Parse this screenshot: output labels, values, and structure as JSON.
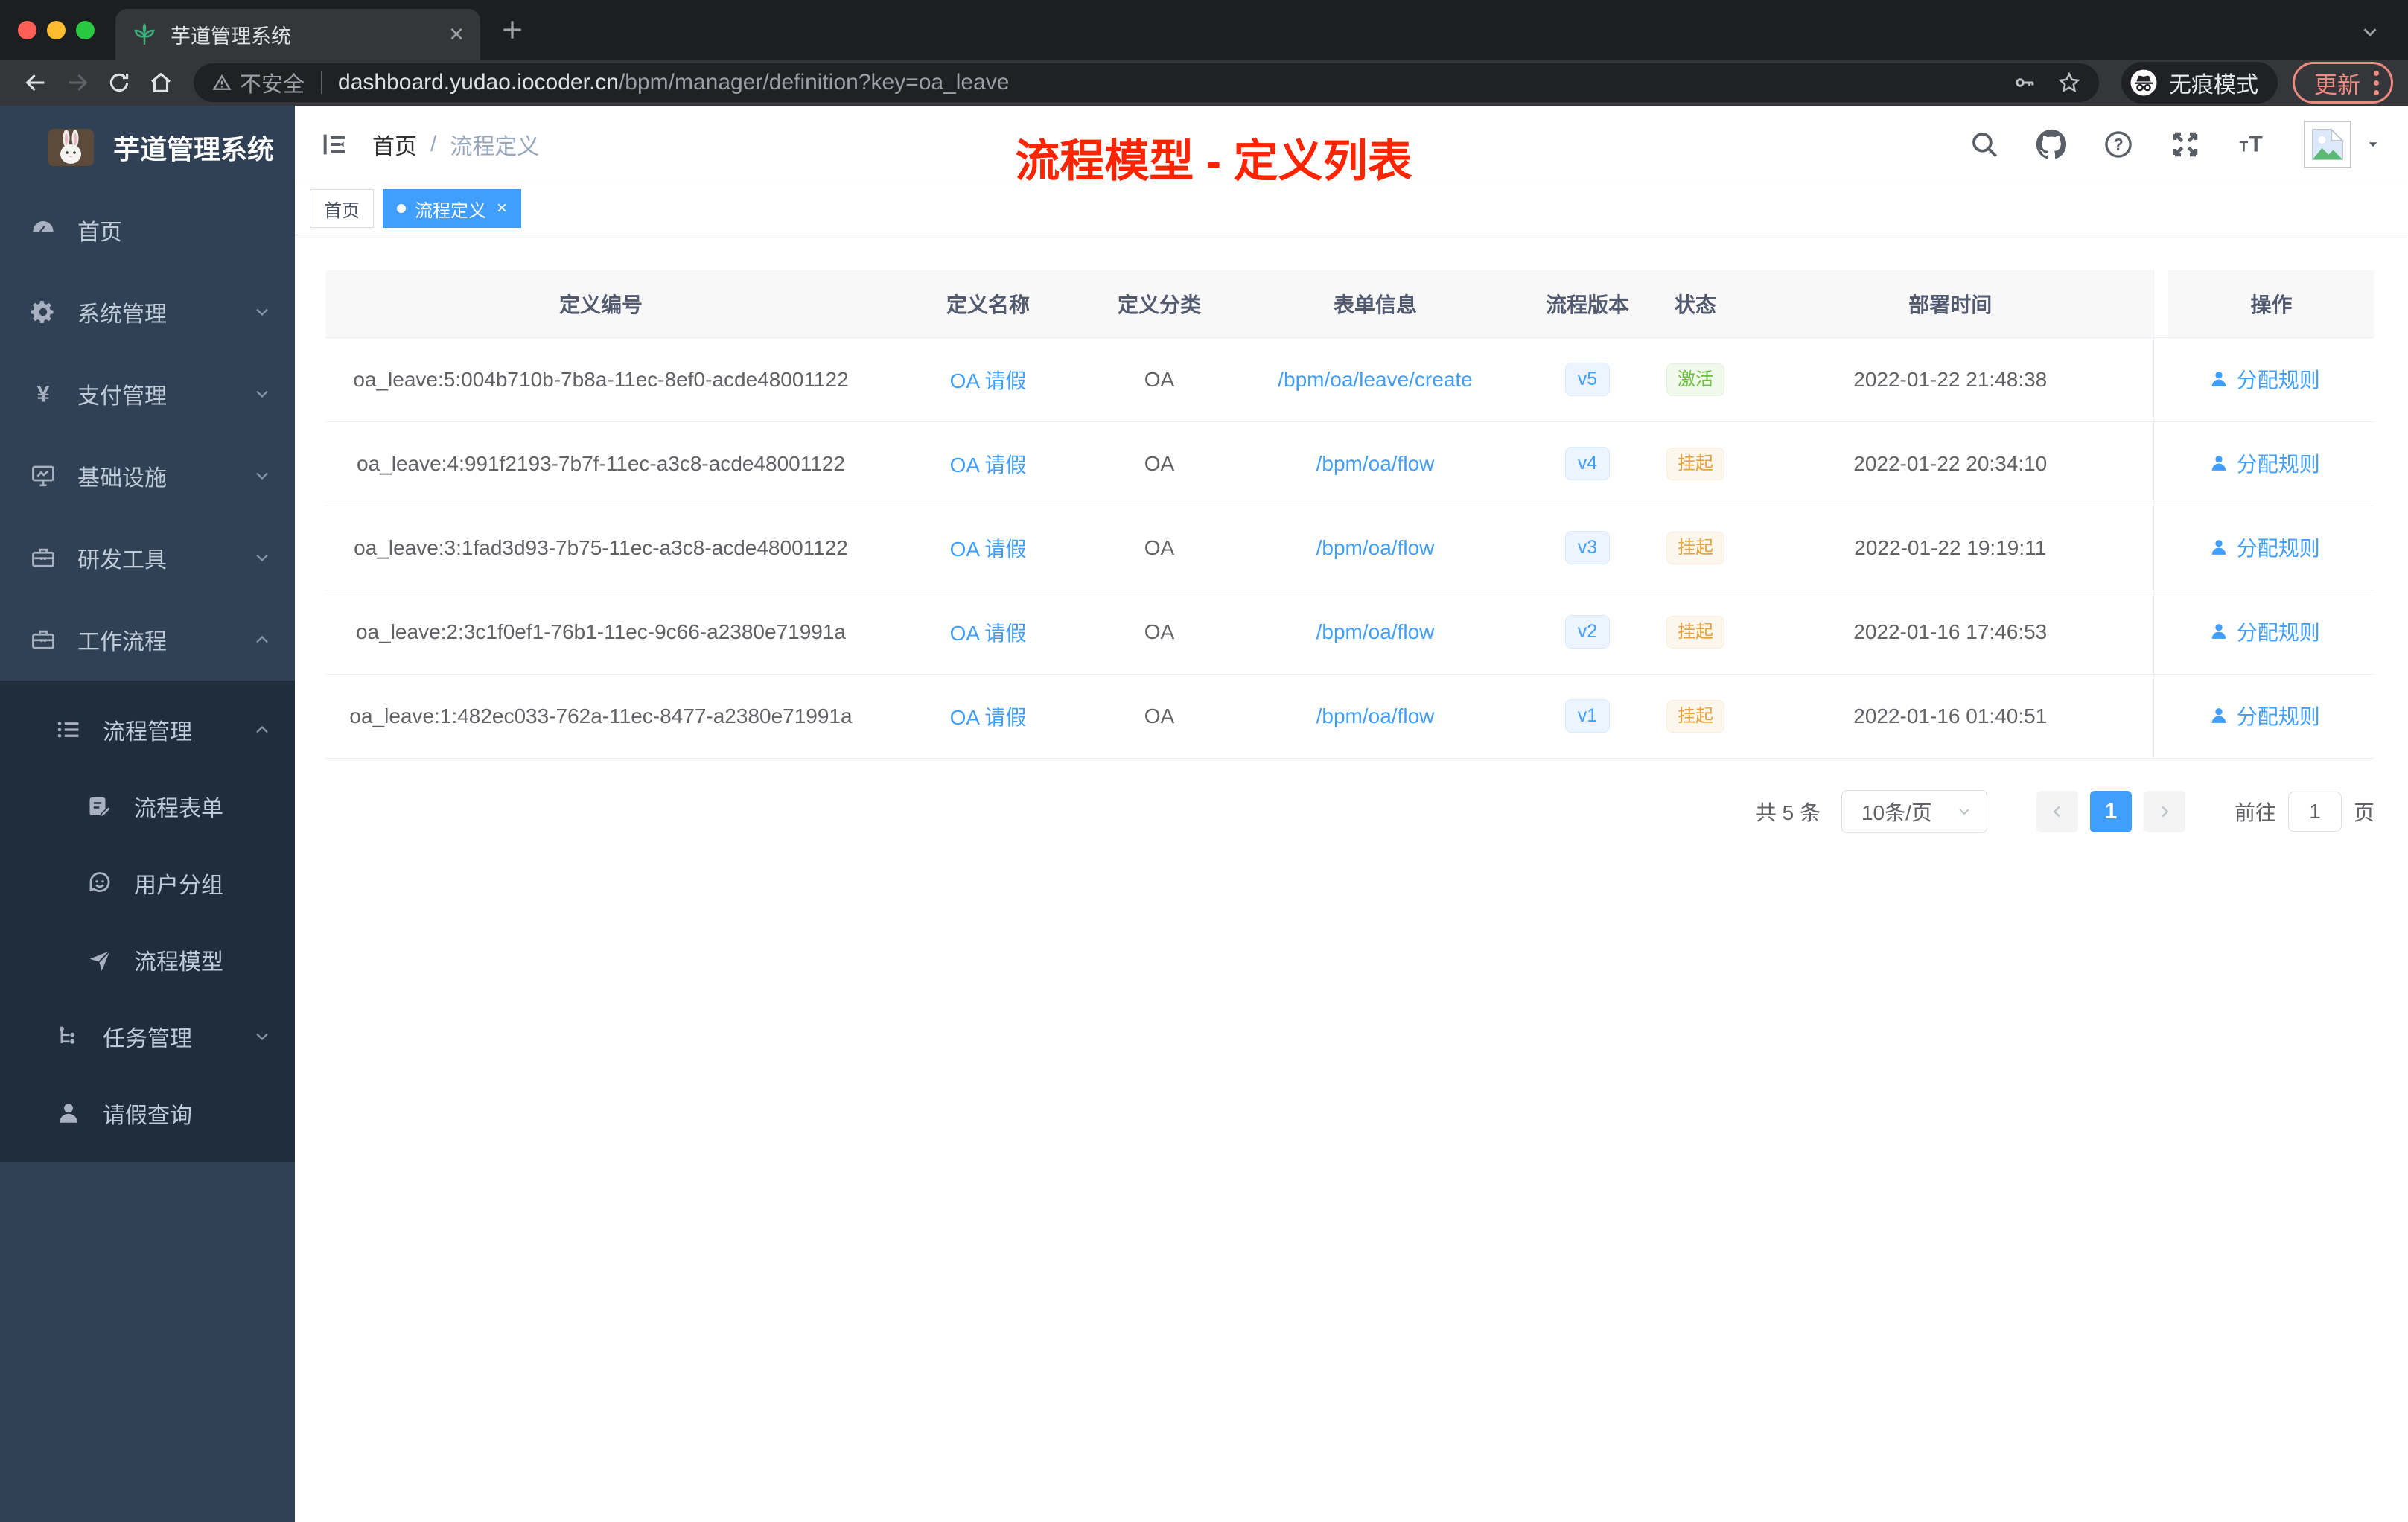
{
  "browser": {
    "tab_title": "芋道管理系统",
    "security_label": "不安全",
    "url_domain": "dashboard.yudao.iocoder.cn",
    "url_path": "/bpm/manager/definition?key=oa_leave",
    "incognito_label": "无痕模式",
    "update_label": "更新"
  },
  "header": {
    "breadcrumb": [
      "首页",
      "流程定义"
    ],
    "annotation": "流程模型 - 定义列表"
  },
  "sidebar": {
    "brand": "芋道管理系统",
    "menu": [
      {
        "icon": "dashboard",
        "label": "首页"
      },
      {
        "icon": "gear",
        "label": "系统管理",
        "chevron": "down"
      },
      {
        "icon": "yen",
        "label": "支付管理",
        "chevron": "down"
      },
      {
        "icon": "monitor",
        "label": "基础设施",
        "chevron": "down"
      },
      {
        "icon": "toolbox",
        "label": "研发工具",
        "chevron": "down"
      },
      {
        "icon": "briefcase",
        "label": "工作流程",
        "chevron": "up",
        "children": [
          {
            "icon": "list",
            "label": "流程管理",
            "chevron": "up",
            "children": [
              {
                "icon": "form",
                "label": "流程表单"
              },
              {
                "icon": "face",
                "label": "用户分组"
              },
              {
                "icon": "send",
                "label": "流程模型"
              }
            ]
          },
          {
            "icon": "tree",
            "label": "任务管理",
            "chevron": "down"
          },
          {
            "icon": "user",
            "label": "请假查询"
          }
        ]
      }
    ]
  },
  "tags": [
    {
      "label": "首页",
      "active": false,
      "closable": false
    },
    {
      "label": "流程定义",
      "active": true,
      "closable": true
    }
  ],
  "table": {
    "columns": [
      "定义编号",
      "定义名称",
      "定义分类",
      "表单信息",
      "流程版本",
      "状态",
      "部署时间",
      "操作"
    ],
    "rows": [
      {
        "id": "oa_leave:5:004b710b-7b8a-11ec-8ef0-acde48001122",
        "name": "OA 请假",
        "category": "OA",
        "form": "/bpm/oa/leave/create",
        "version": "v5",
        "status": {
          "label": "激活",
          "type": "active"
        },
        "time": "2022-01-22 21:48:38",
        "action": "分配规则"
      },
      {
        "id": "oa_leave:4:991f2193-7b7f-11ec-a3c8-acde48001122",
        "name": "OA 请假",
        "category": "OA",
        "form": "/bpm/oa/flow",
        "version": "v4",
        "status": {
          "label": "挂起",
          "type": "suspended"
        },
        "time": "2022-01-22 20:34:10",
        "action": "分配规则"
      },
      {
        "id": "oa_leave:3:1fad3d93-7b75-11ec-a3c8-acde48001122",
        "name": "OA 请假",
        "category": "OA",
        "form": "/bpm/oa/flow",
        "version": "v3",
        "status": {
          "label": "挂起",
          "type": "suspended"
        },
        "time": "2022-01-22 19:19:11",
        "action": "分配规则"
      },
      {
        "id": "oa_leave:2:3c1f0ef1-76b1-11ec-9c66-a2380e71991a",
        "name": "OA 请假",
        "category": "OA",
        "form": "/bpm/oa/flow",
        "version": "v2",
        "status": {
          "label": "挂起",
          "type": "suspended"
        },
        "time": "2022-01-16 17:46:53",
        "action": "分配规则"
      },
      {
        "id": "oa_leave:1:482ec033-762a-11ec-8477-a2380e71991a",
        "name": "OA 请假",
        "category": "OA",
        "form": "/bpm/oa/flow",
        "version": "v1",
        "status": {
          "label": "挂起",
          "type": "suspended"
        },
        "time": "2022-01-16 01:40:51",
        "action": "分配规则"
      }
    ]
  },
  "pagination": {
    "total": "共 5 条",
    "page_size": "10条/页",
    "current_page": "1",
    "goto_label": "前往",
    "goto_value": "1",
    "page_unit": "页"
  },
  "colors": {
    "accent": "#409eff",
    "status_active": "#67c23a",
    "status_suspended": "#e6a23c",
    "annotation_red": "#ff2400",
    "sidebar_bg": "#304156",
    "submenu_bg": "#1f2d3d"
  }
}
